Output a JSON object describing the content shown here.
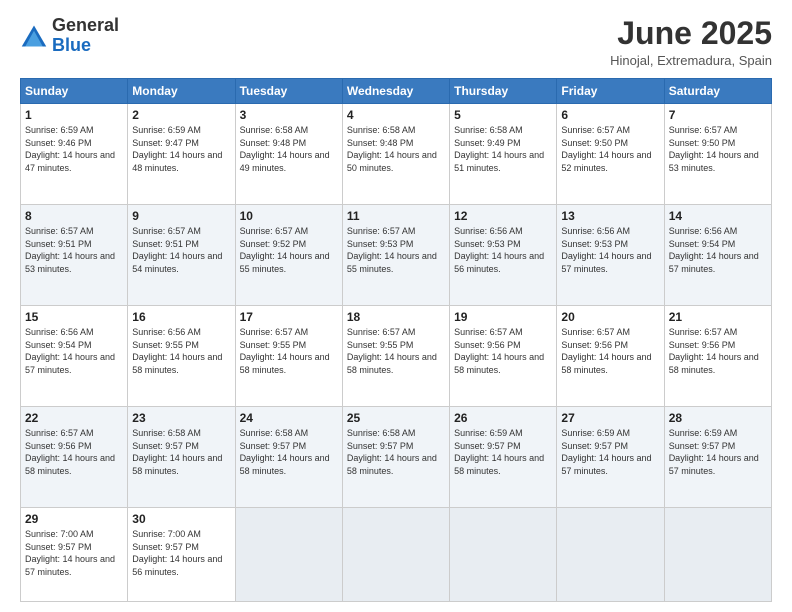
{
  "logo": {
    "text_general": "General",
    "text_blue": "Blue"
  },
  "title": {
    "month_year": "June 2025",
    "location": "Hinojal, Extremadura, Spain"
  },
  "days_of_week": [
    "Sunday",
    "Monday",
    "Tuesday",
    "Wednesday",
    "Thursday",
    "Friday",
    "Saturday"
  ],
  "weeks": [
    [
      {
        "day": "1",
        "sunrise": "6:59 AM",
        "sunset": "9:46 PM",
        "daylight": "14 hours and 47 minutes."
      },
      {
        "day": "2",
        "sunrise": "6:59 AM",
        "sunset": "9:47 PM",
        "daylight": "14 hours and 48 minutes."
      },
      {
        "day": "3",
        "sunrise": "6:58 AM",
        "sunset": "9:48 PM",
        "daylight": "14 hours and 49 minutes."
      },
      {
        "day": "4",
        "sunrise": "6:58 AM",
        "sunset": "9:48 PM",
        "daylight": "14 hours and 50 minutes."
      },
      {
        "day": "5",
        "sunrise": "6:58 AM",
        "sunset": "9:49 PM",
        "daylight": "14 hours and 51 minutes."
      },
      {
        "day": "6",
        "sunrise": "6:57 AM",
        "sunset": "9:50 PM",
        "daylight": "14 hours and 52 minutes."
      },
      {
        "day": "7",
        "sunrise": "6:57 AM",
        "sunset": "9:50 PM",
        "daylight": "14 hours and 53 minutes."
      }
    ],
    [
      {
        "day": "8",
        "sunrise": "6:57 AM",
        "sunset": "9:51 PM",
        "daylight": "14 hours and 53 minutes."
      },
      {
        "day": "9",
        "sunrise": "6:57 AM",
        "sunset": "9:51 PM",
        "daylight": "14 hours and 54 minutes."
      },
      {
        "day": "10",
        "sunrise": "6:57 AM",
        "sunset": "9:52 PM",
        "daylight": "14 hours and 55 minutes."
      },
      {
        "day": "11",
        "sunrise": "6:57 AM",
        "sunset": "9:53 PM",
        "daylight": "14 hours and 55 minutes."
      },
      {
        "day": "12",
        "sunrise": "6:56 AM",
        "sunset": "9:53 PM",
        "daylight": "14 hours and 56 minutes."
      },
      {
        "day": "13",
        "sunrise": "6:56 AM",
        "sunset": "9:53 PM",
        "daylight": "14 hours and 57 minutes."
      },
      {
        "day": "14",
        "sunrise": "6:56 AM",
        "sunset": "9:54 PM",
        "daylight": "14 hours and 57 minutes."
      }
    ],
    [
      {
        "day": "15",
        "sunrise": "6:56 AM",
        "sunset": "9:54 PM",
        "daylight": "14 hours and 57 minutes."
      },
      {
        "day": "16",
        "sunrise": "6:56 AM",
        "sunset": "9:55 PM",
        "daylight": "14 hours and 58 minutes."
      },
      {
        "day": "17",
        "sunrise": "6:57 AM",
        "sunset": "9:55 PM",
        "daylight": "14 hours and 58 minutes."
      },
      {
        "day": "18",
        "sunrise": "6:57 AM",
        "sunset": "9:55 PM",
        "daylight": "14 hours and 58 minutes."
      },
      {
        "day": "19",
        "sunrise": "6:57 AM",
        "sunset": "9:56 PM",
        "daylight": "14 hours and 58 minutes."
      },
      {
        "day": "20",
        "sunrise": "6:57 AM",
        "sunset": "9:56 PM",
        "daylight": "14 hours and 58 minutes."
      },
      {
        "day": "21",
        "sunrise": "6:57 AM",
        "sunset": "9:56 PM",
        "daylight": "14 hours and 58 minutes."
      }
    ],
    [
      {
        "day": "22",
        "sunrise": "6:57 AM",
        "sunset": "9:56 PM",
        "daylight": "14 hours and 58 minutes."
      },
      {
        "day": "23",
        "sunrise": "6:58 AM",
        "sunset": "9:57 PM",
        "daylight": "14 hours and 58 minutes."
      },
      {
        "day": "24",
        "sunrise": "6:58 AM",
        "sunset": "9:57 PM",
        "daylight": "14 hours and 58 minutes."
      },
      {
        "day": "25",
        "sunrise": "6:58 AM",
        "sunset": "9:57 PM",
        "daylight": "14 hours and 58 minutes."
      },
      {
        "day": "26",
        "sunrise": "6:59 AM",
        "sunset": "9:57 PM",
        "daylight": "14 hours and 58 minutes."
      },
      {
        "day": "27",
        "sunrise": "6:59 AM",
        "sunset": "9:57 PM",
        "daylight": "14 hours and 57 minutes."
      },
      {
        "day": "28",
        "sunrise": "6:59 AM",
        "sunset": "9:57 PM",
        "daylight": "14 hours and 57 minutes."
      }
    ],
    [
      {
        "day": "29",
        "sunrise": "7:00 AM",
        "sunset": "9:57 PM",
        "daylight": "14 hours and 57 minutes."
      },
      {
        "day": "30",
        "sunrise": "7:00 AM",
        "sunset": "9:57 PM",
        "daylight": "14 hours and 56 minutes."
      },
      null,
      null,
      null,
      null,
      null
    ]
  ]
}
